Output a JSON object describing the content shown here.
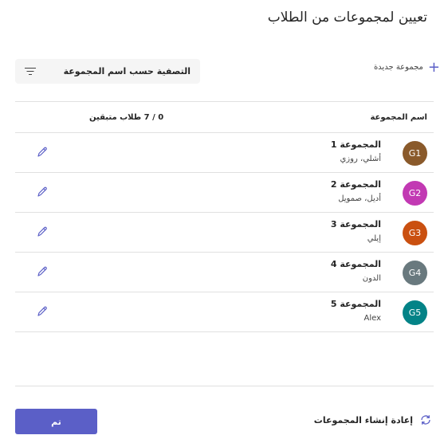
{
  "header": {
    "title": "تعيين لمجموعات من الطلاب"
  },
  "toolbar": {
    "add_group_label": "مجموعة جديدة",
    "sort_label": "التصفية حسب اسم المجموعة"
  },
  "table": {
    "col_group_name": "اسم المجموعة",
    "col_remaining": "0 / 7 طلاب متبقين"
  },
  "groups": [
    {
      "initials": "G1",
      "name": "المجموعة 1",
      "members": "أشلي، روزي",
      "color": "#8a5a2b"
    },
    {
      "initials": "G2",
      "name": "المجموعة 2",
      "members": "أديل، صمويل",
      "color": "#c239b3"
    },
    {
      "initials": "G3",
      "name": "المجموعة 3",
      "members": "إيلي",
      "color": "#ca5010"
    },
    {
      "initials": "G4",
      "name": "المجموعة 4",
      "members": "الدون",
      "color": "#69797e"
    },
    {
      "initials": "G5",
      "name": "المجموعة 5",
      "members": "Alex",
      "color": "#038387"
    }
  ],
  "footer": {
    "regenerate_label": "إعادة إنشاء المجموعات",
    "done_label": "تم"
  },
  "colors": {
    "accent": "#5b5fc7"
  }
}
